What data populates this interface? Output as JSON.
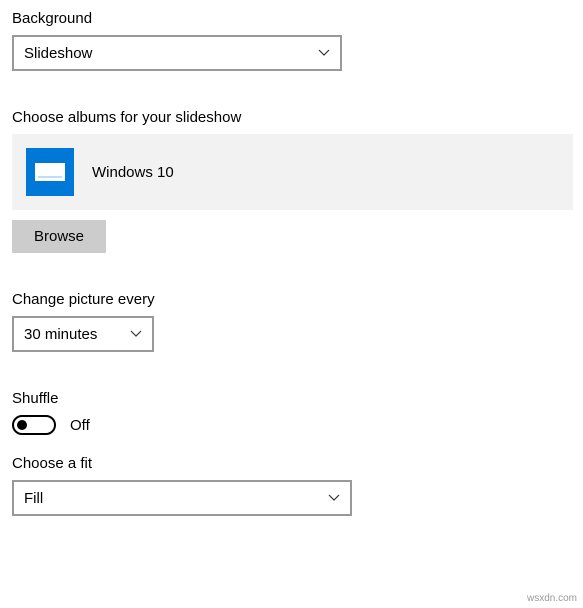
{
  "background": {
    "label": "Background",
    "value": "Slideshow"
  },
  "albums": {
    "label": "Choose albums for your slideshow",
    "selected": "Windows 10",
    "browse": "Browse"
  },
  "changeEvery": {
    "label": "Change picture every",
    "value": "30 minutes"
  },
  "shuffle": {
    "label": "Shuffle",
    "state": "Off"
  },
  "fit": {
    "label": "Choose a fit",
    "value": "Fill"
  },
  "watermark": "wsxdn.com"
}
